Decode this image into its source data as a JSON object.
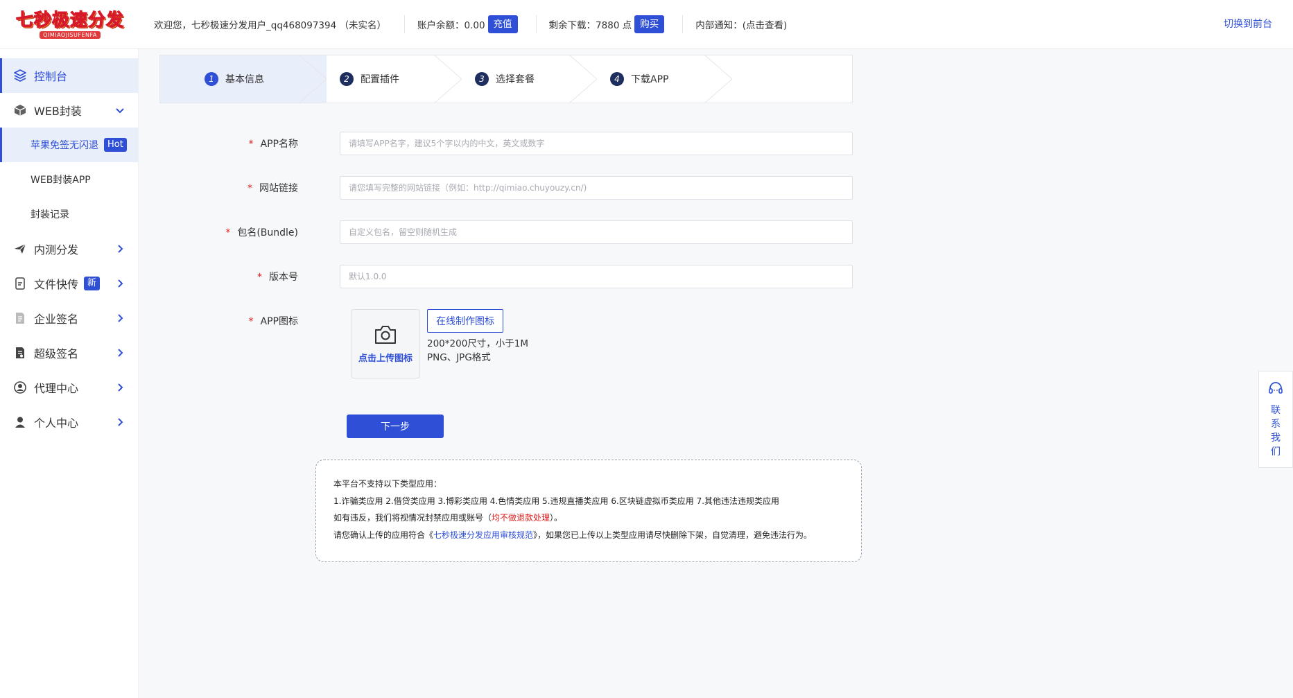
{
  "header": {
    "logo_text": "七秒极速分发",
    "logo_sub": "QIMIAOJISUFENFA",
    "welcome": "欢迎您，七秒极速分发用户_qq468097394 （未实名）",
    "balance_label": "账户余额：0.00",
    "recharge_label": "充值",
    "downloads_label": "剩余下载：7880 点",
    "buy_label": "购买",
    "notice_label": "内部通知：(点击查看)",
    "switch_label": "切换到前台"
  },
  "sidebar": {
    "items": [
      {
        "label": "控制台",
        "icon": "layers-icon"
      },
      {
        "label": "WEB封装",
        "icon": "box-icon"
      },
      {
        "label": "内测分发",
        "icon": "paper-plane-icon"
      },
      {
        "label": "文件快传",
        "icon": "file-transfer-icon",
        "tag": "新"
      },
      {
        "label": "企业签名",
        "icon": "document-icon"
      },
      {
        "label": "超级签名",
        "icon": "file-sign-icon"
      },
      {
        "label": "代理中心",
        "icon": "agent-icon"
      },
      {
        "label": "个人中心",
        "icon": "user-icon"
      }
    ],
    "sub_items": [
      {
        "label": "苹果免签无闪退",
        "tag": "Hot"
      },
      {
        "label": "WEB封装APP"
      },
      {
        "label": "封装记录"
      }
    ]
  },
  "steps": [
    {
      "num": "1",
      "label": "基本信息"
    },
    {
      "num": "2",
      "label": "配置插件"
    },
    {
      "num": "3",
      "label": "选择套餐"
    },
    {
      "num": "4",
      "label": "下载APP"
    }
  ],
  "form": {
    "app_name": {
      "label": "APP名称",
      "placeholder": "请填写APP名字，建议5个字以内的中文，英文或数字"
    },
    "site_url": {
      "label": "网站链接",
      "placeholder": "请您填写完整的网站链接（例如：http://qimiao.chuyouzy.cn/)"
    },
    "bundle": {
      "label": "包名(Bundle)",
      "placeholder": "自定义包名，留空则随机生成"
    },
    "version": {
      "label": "版本号",
      "placeholder": "默认1.0.0"
    },
    "icon": {
      "label": "APP图标",
      "upload_label": "点击上传图标",
      "make_online_label": "在线制作图标",
      "hint_size": "200*200尺寸，小于1M",
      "hint_format": "PNG、JPG格式"
    },
    "required_mark": "*",
    "next_label": "下一步"
  },
  "notice": {
    "line1": "本平台不支持以下类型应用：",
    "line2": "1.诈骗类应用 2.借贷类应用 3.博彩类应用 4.色情类应用 5.违规直播类应用 6.区块链虚拟币类应用 7.其他违法违规类应用",
    "line3_prefix": "如有违反，我们将视情况封禁应用或账号（",
    "line3_red": "均不做退款处理",
    "line3_suffix": "）。",
    "line4_prefix": "请您确认上传的应用符合《",
    "line4_link": "七秒极速分发应用审核规范",
    "line4_suffix": "》，如果您已上传以上类型应用请尽快删除下架，自觉清理，避免违法行为。"
  },
  "contact": {
    "label": "联系我们",
    "icon": "headset-icon"
  },
  "colors": {
    "accent": "#2e4fd6",
    "required": "#e02020",
    "active_bg": "#e9eefb"
  }
}
